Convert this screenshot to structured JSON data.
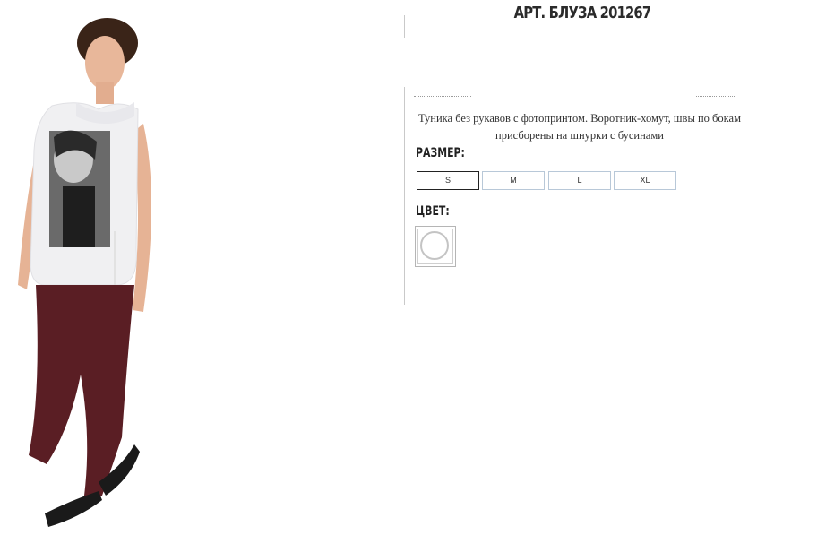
{
  "product": {
    "title": "АРТ. БЛУЗА 201267",
    "description": "Туника без рукавов с фотопринтом. Воротник-хомут, швы по бокам присборены на шнурки с бусинами",
    "size_label": "РАЗМЕР:",
    "color_label": "ЦВЕТ:",
    "sizes": [
      {
        "label": "S",
        "selected": true
      },
      {
        "label": "M",
        "selected": false
      },
      {
        "label": "L",
        "selected": false
      },
      {
        "label": "XL",
        "selected": false
      }
    ],
    "color_swatch": {
      "name": "white-swatch",
      "color": "#ffffff"
    }
  },
  "photo": {
    "top_color": "#f0f0f2",
    "pants_color": "#5a1e24",
    "skin_color": "#e8b79a",
    "hair_color": "#3a2418",
    "shoe_color": "#1a1a1a"
  }
}
